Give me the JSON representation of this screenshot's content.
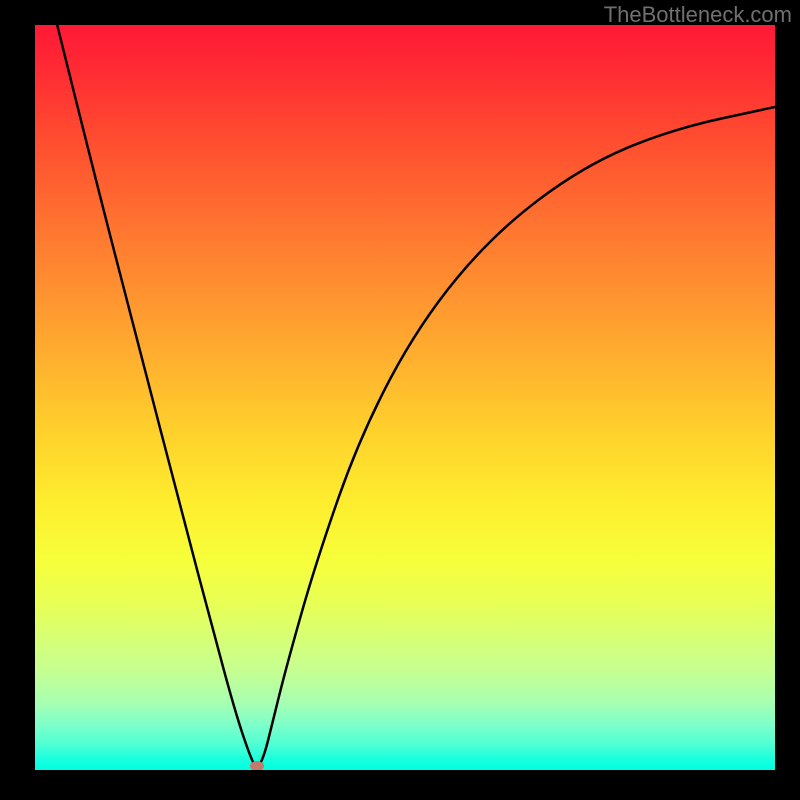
{
  "watermark": "TheBottleneck.com",
  "colors": {
    "gradient_top": "#ff1936",
    "gradient_mid": "#ffcf2c",
    "gradient_bottom": "#00ffe0",
    "curve": "#000000",
    "marker": "#c17a6d",
    "background": "#000000"
  },
  "chart_data": {
    "type": "line",
    "title": "",
    "xlabel": "",
    "ylabel": "",
    "xlim": [
      0,
      100
    ],
    "ylim": [
      0,
      100
    ],
    "grid": false,
    "series": [
      {
        "name": "bottleneck-curve",
        "x": [
          3,
          8,
          14,
          20,
          24,
          27,
          29,
          30,
          31,
          32,
          34,
          38,
          44,
          52,
          62,
          74,
          86,
          100
        ],
        "y": [
          100,
          80,
          57,
          34,
          19,
          8,
          2,
          0,
          2,
          6,
          14,
          28,
          45,
          60,
          72,
          81,
          86,
          89
        ]
      }
    ],
    "annotations": [
      {
        "name": "marker-min",
        "x": 30,
        "y": 0.5
      }
    ],
    "background_gradient": {
      "orientation": "vertical",
      "stops": [
        {
          "pos": 0.0,
          "color": "#ff1936"
        },
        {
          "pos": 0.5,
          "color": "#ffcf2c"
        },
        {
          "pos": 0.72,
          "color": "#f6ff3b"
        },
        {
          "pos": 1.0,
          "color": "#00ffe0"
        }
      ]
    }
  }
}
